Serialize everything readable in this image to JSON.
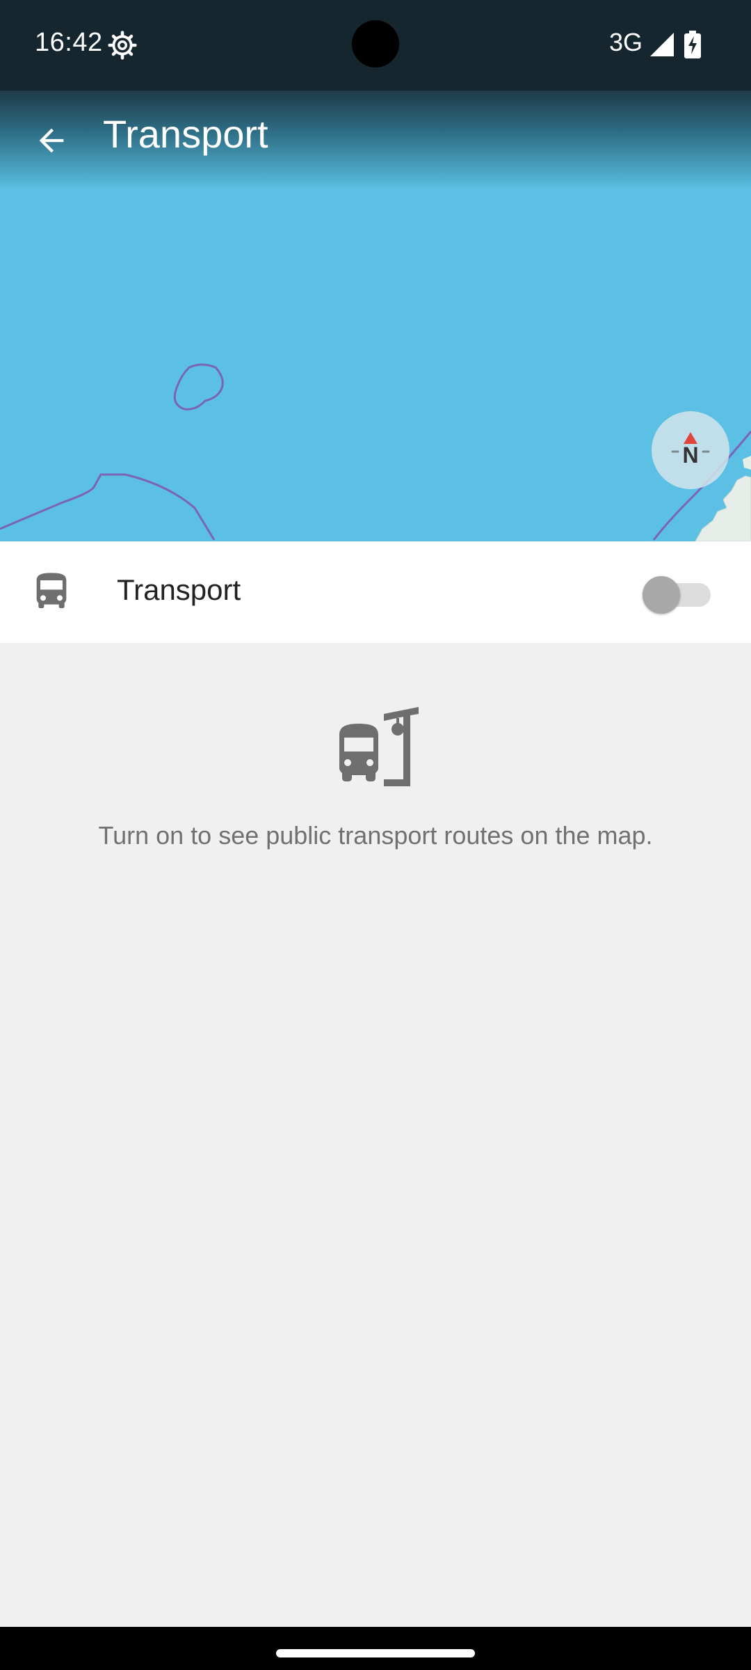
{
  "status_bar": {
    "time": "16:42",
    "network": "3G",
    "icons": [
      "settings-gear-icon",
      "cell-signal-icon",
      "battery-charging-icon"
    ]
  },
  "app_bar": {
    "title": "Transport",
    "back_icon": "arrow-back-icon"
  },
  "map": {
    "compass_label": "N",
    "water_color": "#5bc0e3",
    "coast_color": "#7b63b8"
  },
  "transport_row": {
    "label": "Transport",
    "icon": "bus-icon",
    "switch_on": false
  },
  "info": {
    "icon": "bus-stop-icon",
    "text": "Turn on to see public transport routes on the map."
  }
}
